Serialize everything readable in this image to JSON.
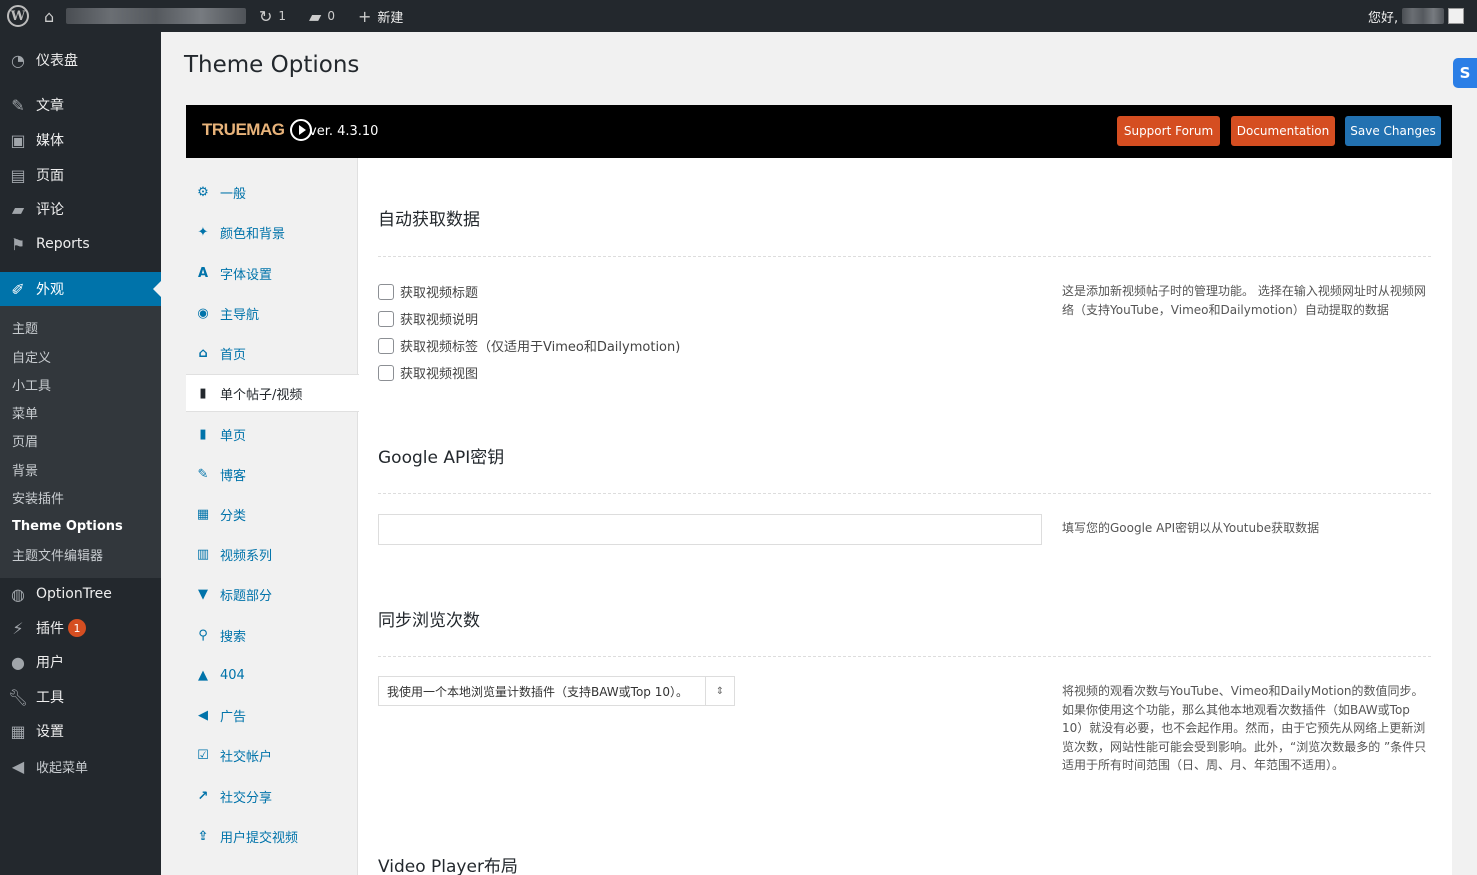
{
  "adminbar": {
    "updates_count": "1",
    "comments_count": "0",
    "new_label": "新建",
    "greeting": "您好,"
  },
  "sidebar": {
    "items": [
      {
        "label": "仪表盘",
        "icon": "dashboard-icon"
      },
      {
        "label": "文章",
        "icon": "pin-icon"
      },
      {
        "label": "媒体",
        "icon": "media-icon"
      },
      {
        "label": "页面",
        "icon": "page-icon"
      },
      {
        "label": "评论",
        "icon": "comment-icon"
      },
      {
        "label": "Reports",
        "icon": "flag-icon"
      },
      {
        "label": "外观",
        "icon": "brush-icon"
      }
    ],
    "submenu": [
      "主题",
      "自定义",
      "小工具",
      "菜单",
      "页眉",
      "背景",
      "安装插件",
      "Theme Options",
      "主题文件编辑器"
    ],
    "lower_items": [
      {
        "label": "OptionTree",
        "icon": "optiontree-icon"
      },
      {
        "label": "插件",
        "icon": "plugin-icon",
        "badge": "1"
      },
      {
        "label": "用户",
        "icon": "user-icon"
      },
      {
        "label": "工具",
        "icon": "wrench-icon"
      },
      {
        "label": "设置",
        "icon": "settings-icon"
      },
      {
        "label": "收起菜单",
        "icon": "collapse-icon"
      }
    ]
  },
  "page": {
    "title": "Theme Options"
  },
  "panel": {
    "logo_text": "TRUEMAG",
    "version": "ver. 4.3.10",
    "buttons": {
      "support": "Support Forum",
      "docs": "Documentation",
      "save": "Save Changes"
    },
    "colors": {
      "support": "#d54e21",
      "docs": "#d54e21",
      "save": "#2271b1"
    }
  },
  "tabs": [
    {
      "label": "一般",
      "icon": "gears-icon"
    },
    {
      "label": "颜色和背景",
      "icon": "magic-icon"
    },
    {
      "label": "字体设置",
      "icon": "font-icon"
    },
    {
      "label": "主导航",
      "icon": "compass-icon"
    },
    {
      "label": "首页",
      "icon": "home-icon"
    },
    {
      "label": "单个帖子/视频",
      "icon": "file-icon"
    },
    {
      "label": "单页",
      "icon": "file-icon"
    },
    {
      "label": "博客",
      "icon": "pencil-icon"
    },
    {
      "label": "分类",
      "icon": "grid-icon"
    },
    {
      "label": "视频系列",
      "icon": "film-icon"
    },
    {
      "label": "标题部分",
      "icon": "bookmark-icon"
    },
    {
      "label": "搜索",
      "icon": "search-icon"
    },
    {
      "label": "404",
      "icon": "warning-icon"
    },
    {
      "label": "广告",
      "icon": "bullhorn-icon"
    },
    {
      "label": "社交帐户",
      "icon": "checkbox-icon"
    },
    {
      "label": "社交分享",
      "icon": "share-icon"
    },
    {
      "label": "用户提交视频",
      "icon": "upload-icon"
    }
  ],
  "sections": {
    "auto_fetch": {
      "title": "自动获取数据",
      "options": [
        "获取视频标题",
        "获取视频说明",
        "获取视频标签（仅适用于Vimeo和Dailymotion)",
        "获取视频视图"
      ],
      "desc": "这是添加新视频帖子时的管理功能。 选择在输入视频网址时从视频网络（支持YouTube，Vimeo和Dailymotion）自动提取的数据"
    },
    "google_api": {
      "title": "Google API密钥",
      "value": "",
      "desc": "填写您的Google API密钥以从Youtube获取数据"
    },
    "sync_views": {
      "title": "同步浏览次数",
      "selected": "我使用一个本地浏览量计数插件（支持BAW或Top 10）。",
      "desc": "将视频的观看次数与YouTube、Vimeo和DailyMotion的数值同步。如果你使用这个功能，那么其他本地观看次数插件（如BAW或Top 10）就没有必要，也不会起作用。然而，由于它预先从网络上更新浏览次数，网站性能可能会受到影响。此外，“浏览次数最多的 ”条件只适用于所有时间范围（日、周、月、年范围不适用）。"
    },
    "video_player": {
      "title": "Video Player布局"
    }
  }
}
